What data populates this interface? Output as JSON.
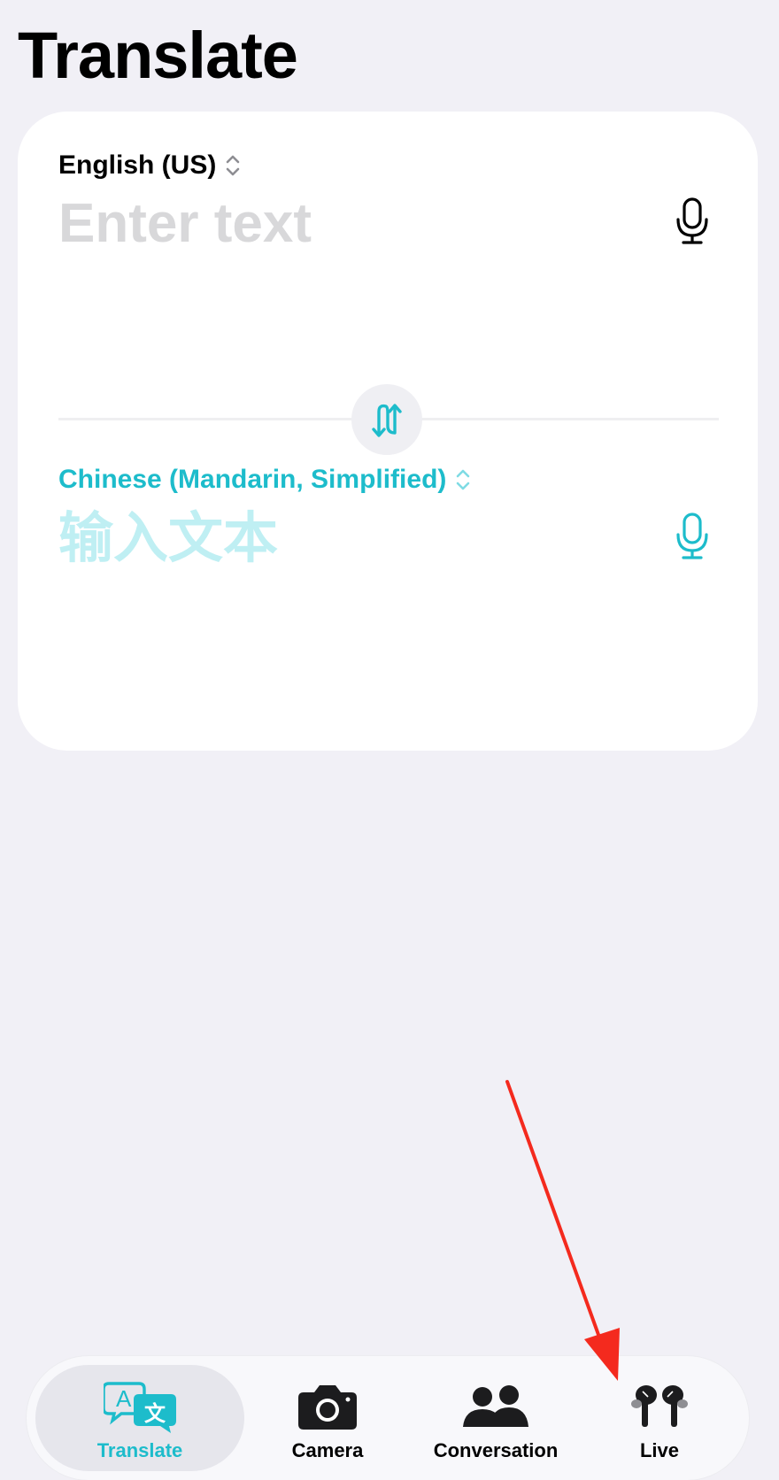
{
  "page": {
    "title": "Translate"
  },
  "source": {
    "language": "English (US)",
    "placeholder": "Enter text",
    "value": ""
  },
  "target": {
    "language": "Chinese (Mandarin, Simplified)",
    "placeholder": "输入文本",
    "value": ""
  },
  "tabs": [
    {
      "label": "Translate",
      "icon": "translate-bubbles-icon",
      "active": true
    },
    {
      "label": "Camera",
      "icon": "camera-icon",
      "active": false
    },
    {
      "label": "Conversation",
      "icon": "people-icon",
      "active": false
    },
    {
      "label": "Live",
      "icon": "airpods-icon",
      "active": false
    }
  ],
  "colors": {
    "accent": "#1dbccb",
    "background": "#f1f0f6",
    "card": "#ffffff",
    "annotation_arrow": "#f42a1e"
  }
}
